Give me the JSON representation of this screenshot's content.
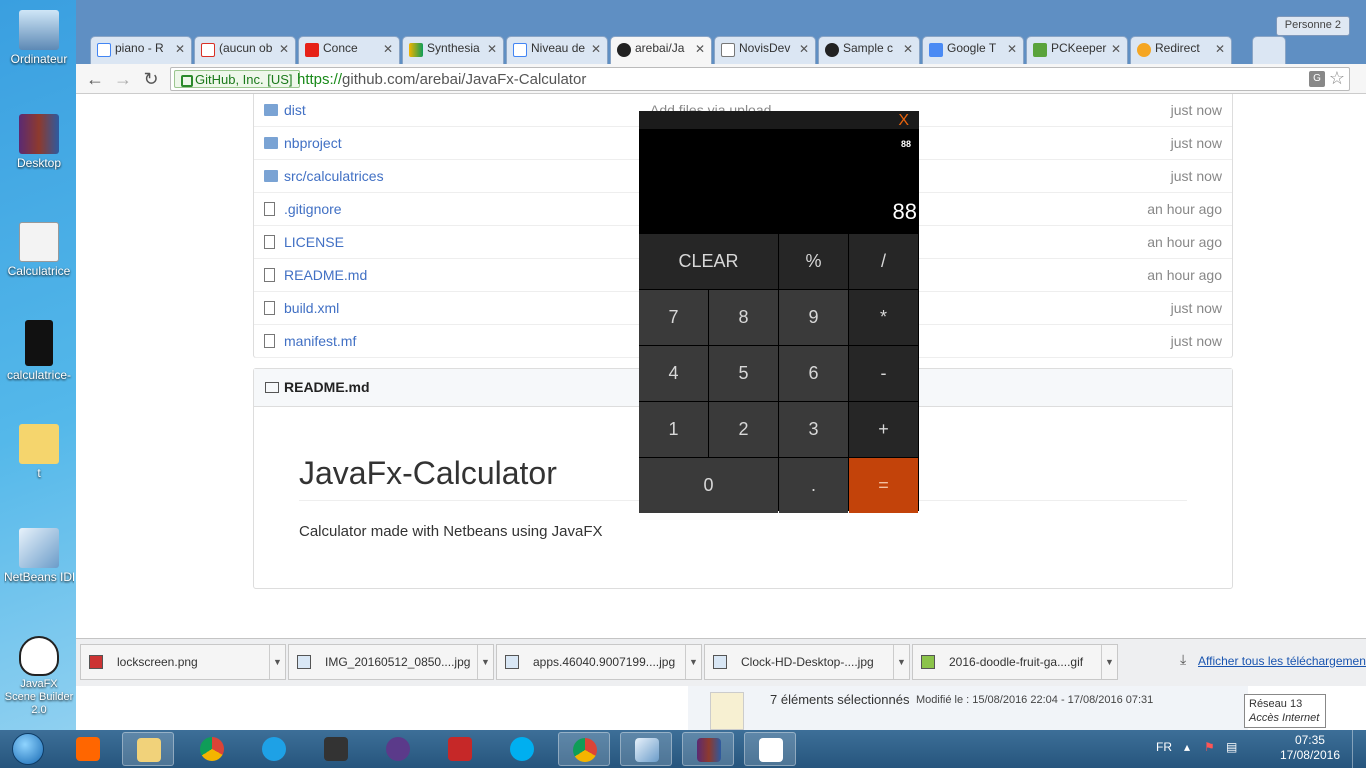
{
  "desktop": {
    "icons": [
      {
        "label": "Ordinateur"
      },
      {
        "label": "Desktop"
      },
      {
        "label": "Calculatrice"
      },
      {
        "label": "calculatrice-"
      },
      {
        "label": "t"
      },
      {
        "label": "NetBeans IDE"
      },
      {
        "label": "JavaFX Scene Builder 2.0"
      }
    ]
  },
  "browser": {
    "profile": "Personne 2",
    "close": "X",
    "tabs": [
      {
        "label": "piano - R",
        "icon": "google-icon"
      },
      {
        "label": "(aucun ob",
        "icon": "gmail-icon"
      },
      {
        "label": "Conce",
        "icon": "youtube-icon"
      },
      {
        "label": "Synthesia",
        "icon": "synthesia-icon"
      },
      {
        "label": "Niveau de",
        "icon": "google-icon"
      },
      {
        "label": "arebai/Ja",
        "icon": "github-icon"
      },
      {
        "label": "NovisDev",
        "icon": "page-icon"
      },
      {
        "label": "Sample c",
        "icon": "github-icon"
      },
      {
        "label": "Google T",
        "icon": "google-translate-icon"
      },
      {
        "label": "PCKeeper",
        "icon": "pckeeper-icon"
      },
      {
        "label": "Redirect",
        "icon": "redirect-icon"
      }
    ],
    "tab_close": "✕",
    "nav": {
      "back": "←",
      "forward": "→",
      "reload": "↻"
    },
    "security_badge": "GitHub, Inc. [US]",
    "url_scheme": "https://",
    "url_host": "github.com",
    "url_path": "/arebai/JavaFx-Calculator",
    "star": "☆"
  },
  "repo": {
    "files": [
      {
        "name": "dist",
        "type": "folder",
        "message": "Add files via upload",
        "age": "just now"
      },
      {
        "name": "nbproject",
        "type": "folder",
        "message": "",
        "age": "just now"
      },
      {
        "name": "src/calculatrices",
        "type": "folder",
        "message": "",
        "age": "just now"
      },
      {
        "name": ".gitignore",
        "type": "file",
        "message": "",
        "age": "an hour ago"
      },
      {
        "name": "LICENSE",
        "type": "file",
        "message": "",
        "age": "an hour ago"
      },
      {
        "name": "README.md",
        "type": "file",
        "message": "",
        "age": "an hour ago"
      },
      {
        "name": "build.xml",
        "type": "file",
        "message": "",
        "age": "just now"
      },
      {
        "name": "manifest.mf",
        "type": "file",
        "message": "",
        "age": "just now"
      }
    ],
    "readme": {
      "header": "README.md",
      "title": "JavaFx-Calculator",
      "description": "Calculator made with Netbeans using JavaFX"
    }
  },
  "downloads": {
    "items": [
      {
        "name": "lockscreen.png"
      },
      {
        "name": "IMG_20160512_0850....jpg"
      },
      {
        "name": "apps.46040.9007199....jpg"
      },
      {
        "name": "Clock-HD-Desktop-....jpg"
      },
      {
        "name": "2016-doodle-fruit-ga....gif"
      }
    ],
    "show_all": "Afficher tous les téléchargements"
  },
  "explorer": {
    "selection": "7 éléments sélectionnés",
    "modified": "Modifié le : 15/08/2016 22:04 - 17/08/2016 07:31"
  },
  "network_tooltip": {
    "line1": "Réseau  13",
    "line2": "Accès Internet"
  },
  "calculator": {
    "close": "X",
    "expression": "88",
    "display": "88",
    "keys": [
      "CLEAR",
      "%",
      "/",
      "7",
      "8",
      "9",
      "*",
      "4",
      "5",
      "6",
      "-",
      "1",
      "2",
      "3",
      "+",
      "0",
      ".",
      "="
    ]
  },
  "taskbar": {
    "apps": [
      "windows-explorer",
      "chrome",
      "internet-explorer",
      "call-of-duty",
      "spider-solitaire",
      "hearts",
      "skype",
      "chrome-2",
      "virtualbox",
      "winrar",
      "java"
    ],
    "language": "FR",
    "time": "07:35",
    "date": "17/08/2016"
  }
}
